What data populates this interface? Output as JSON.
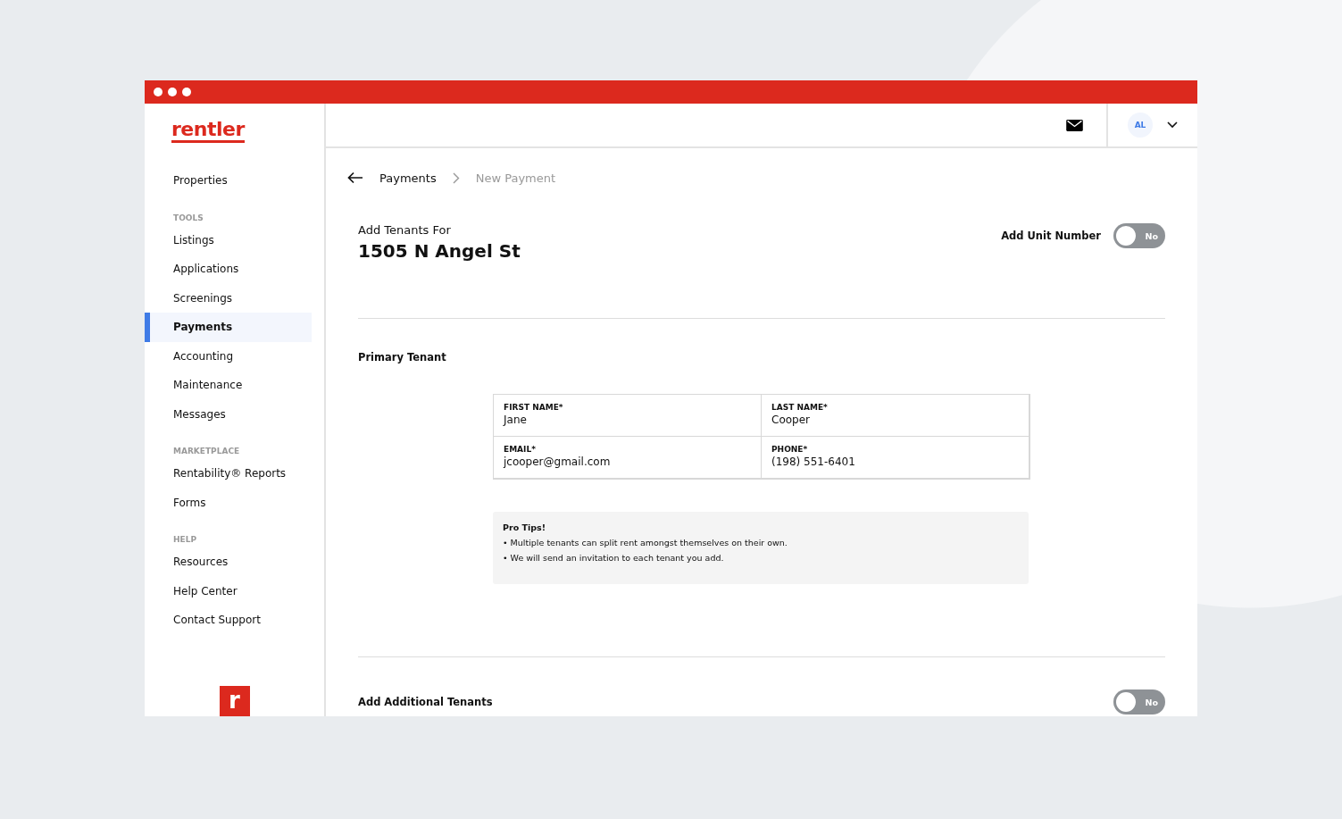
{
  "logo": "rentler",
  "sidebar": {
    "sections": [
      {
        "items": [
          {
            "label": "Properties",
            "selected": false
          }
        ]
      },
      {
        "heading": "TOOLS",
        "items": [
          {
            "label": "Listings",
            "selected": false
          },
          {
            "label": "Applications",
            "selected": false
          },
          {
            "label": "Screenings",
            "selected": false
          },
          {
            "label": "Payments",
            "selected": true
          },
          {
            "label": "Accounting",
            "selected": false
          },
          {
            "label": "Maintenance",
            "selected": false
          },
          {
            "label": "Messages",
            "selected": false
          }
        ]
      },
      {
        "heading": "MARKETPLACE",
        "items": [
          {
            "label": "Rentability® Reports",
            "selected": false
          },
          {
            "label": "Forms",
            "selected": false
          }
        ]
      },
      {
        "heading": "HELP",
        "items": [
          {
            "label": "Resources",
            "selected": false
          },
          {
            "label": "Help Center",
            "selected": false
          },
          {
            "label": "Contact Support",
            "selected": false
          }
        ]
      }
    ],
    "footer_logo": "r"
  },
  "topbar": {
    "avatar": "AL"
  },
  "breadcrumb": [
    "Payments",
    "New Payment"
  ],
  "heading": {
    "subtitle": "Add Tenants For",
    "title": "1505 N Angel St"
  },
  "unit_toggle": {
    "label": "Add Unit Number",
    "on": false,
    "state_text": "No"
  },
  "primary": {
    "title": "Primary Tenant",
    "fields": [
      {
        "label": "FIRST NAME*",
        "value": "Jane"
      },
      {
        "label": "LAST NAME*",
        "value": "Cooper"
      },
      {
        "label": "EMAIL*",
        "value": "jcooper@gmail.com"
      },
      {
        "label": "PHONE*",
        "value": "(198) 551-6401"
      }
    ]
  },
  "tips": {
    "title": "Pro Tips!",
    "lines": [
      "• Multiple tenants can split rent amongst themselves on their own.",
      "• We will send an invitation to each tenant you add."
    ]
  },
  "additional_toggle": {
    "label": "Add Additional Tenants",
    "on": false,
    "state_text": "No"
  }
}
